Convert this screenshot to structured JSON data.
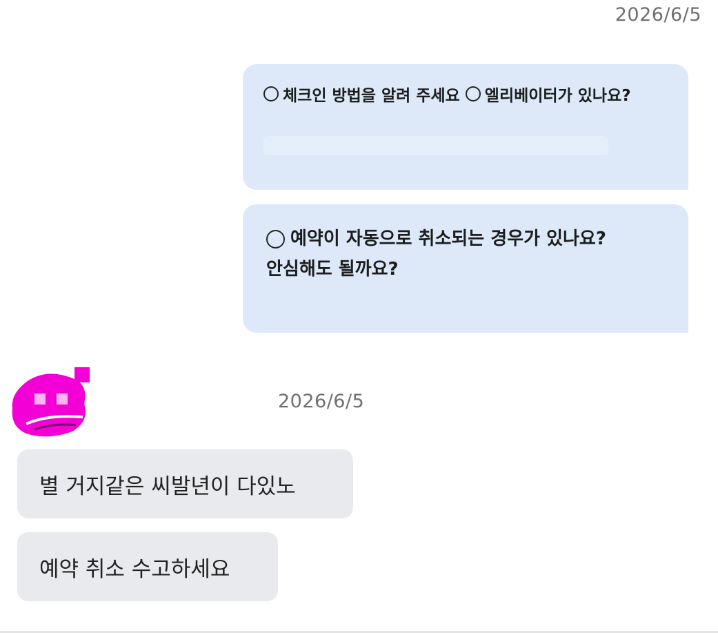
{
  "conversation": {
    "sent_timestamp": "2026/6/5",
    "received_timestamp": "2026/6/5",
    "sent_messages": [
      {
        "options": [
          "체크인 방법을 알려 주세요",
          "엘리베이터가 있나요?"
        ]
      },
      {
        "lines": [
          "예약이 자동으로 취소되는 경우가 있나요?",
          "안심해도 될까요?"
        ]
      }
    ],
    "received_messages": [
      "별 거지같은 씨발년이 다있노",
      "예약 취소 수고하세요"
    ]
  },
  "icons": {
    "option_marker": "radio-circle-icon",
    "sender_avatar": "censored-avatar-icon"
  },
  "colors": {
    "sent_bubble": "#dde9f9",
    "received_bubble": "#e9eaed",
    "timestamp_text": "#6f6f6f",
    "avatar_censor": "#f200d6"
  }
}
